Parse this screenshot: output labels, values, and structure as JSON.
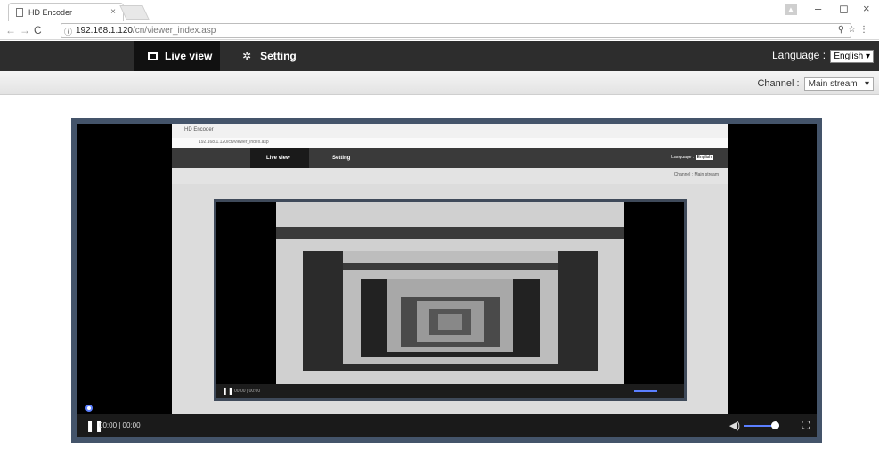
{
  "browser": {
    "tab_title": "HD Encoder",
    "tab_close": "×",
    "url_host": "192.168.1.120",
    "url_path": "/cn/viewer_index.asp",
    "info_icon": "ⓘ"
  },
  "nav": {
    "live_view": "Live view",
    "setting": "Setting",
    "language_label": "Language :",
    "language_value": "English"
  },
  "channel": {
    "label": "Channel :",
    "value": "Main stream"
  },
  "player": {
    "time": "00:00 | 00:00",
    "nested_time": "00:00 | 00:00"
  },
  "nested_browser": {
    "tab_title": "HD Encoder",
    "url": "192.168.1.120/cn/viewer_index.asp",
    "live_view": "Live view",
    "setting": "Setting",
    "language_label": "Language :",
    "language_value": "English",
    "channel_label": "Channel :",
    "channel_value": "Main stream"
  },
  "colors": {
    "nav_bg": "#2d2d2d",
    "nav_active": "#111111",
    "video_border": "#44546a",
    "accent": "#5b7fff"
  }
}
